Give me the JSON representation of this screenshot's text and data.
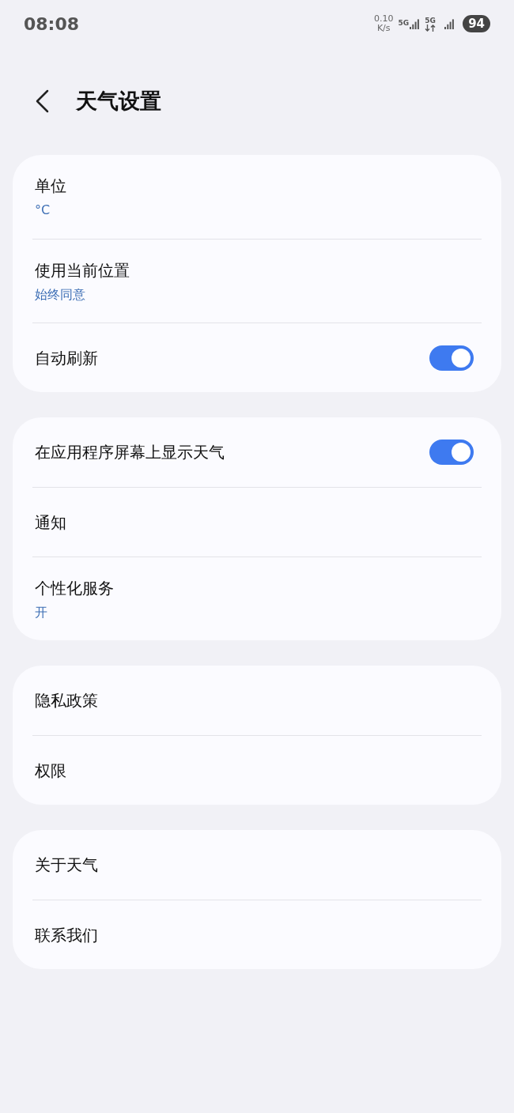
{
  "status_bar": {
    "time": "08:08",
    "speed_value": "0.10",
    "speed_unit": "K/s",
    "network_1": "5G",
    "network_2": "5G",
    "battery": "94"
  },
  "header": {
    "title": "天气设置"
  },
  "groups": [
    {
      "items": [
        {
          "kind": "plain",
          "title": "单位",
          "subtitle": "°C"
        },
        {
          "kind": "plain",
          "title": "使用当前位置",
          "subtitle": "始终同意"
        },
        {
          "kind": "toggle",
          "title": "自动刷新",
          "on": true
        }
      ]
    },
    {
      "items": [
        {
          "kind": "toggle",
          "title": "在应用程序屏幕上显示天气",
          "on": true
        },
        {
          "kind": "plain",
          "title": "通知"
        },
        {
          "kind": "plain",
          "title": "个性化服务",
          "subtitle": "开"
        }
      ]
    },
    {
      "items": [
        {
          "kind": "plain",
          "title": "隐私政策"
        },
        {
          "kind": "plain",
          "title": "权限"
        }
      ]
    },
    {
      "items": [
        {
          "kind": "plain",
          "title": "关于天气"
        },
        {
          "kind": "plain",
          "title": "联系我们"
        }
      ]
    }
  ]
}
